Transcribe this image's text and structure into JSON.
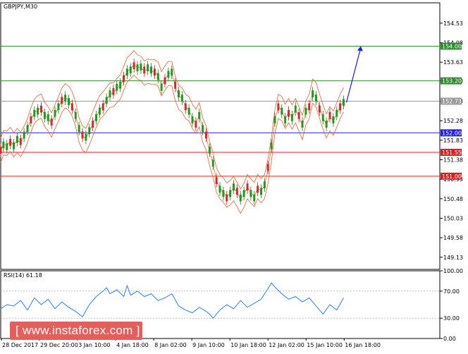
{
  "chart_data": [
    {
      "type": "line",
      "subtype": "candlestick",
      "title": "GBPJPY,M30",
      "xlabel": "",
      "ylabel": "",
      "ylim": [
        148.85,
        155.0
      ],
      "y_tick_labels": [
        "154.53",
        "154.08",
        "153.63",
        "153.20",
        "152.73",
        "152.28",
        "151.83",
        "151.38",
        "150.93",
        "150.48",
        "150.03",
        "149.58",
        "149.13"
      ],
      "x_tick_labels": [
        "28 Dec 2017",
        "29 Dec 20:00",
        "3 Jan 10:00",
        "4 Jan 18:00",
        "8 Jan 02:00",
        "9 Jan 10:00",
        "10 Jan 18:00",
        "12 Jan 02:00",
        "15 Jan 10:00",
        "16 Jan 18:00"
      ],
      "price_labels": [
        {
          "label": "154.00",
          "value": 154.0,
          "color": "#2e8b2e"
        },
        {
          "label": "153.20",
          "value": 153.2,
          "color": "#2e8b2e"
        },
        {
          "label": "152.73",
          "value": 152.73,
          "color": "#9a9a9a"
        },
        {
          "label": "152.00",
          "value": 152.0,
          "color": "#2222dd"
        },
        {
          "label": "151.55",
          "value": 151.55,
          "color": "#d32020"
        },
        {
          "label": "151.00",
          "value": 151.0,
          "color": "#d32020"
        }
      ],
      "series": [
        {
          "values": [
            [
              1,
              151.6
            ],
            [
              5,
              151.72
            ],
            [
              10,
              151.68
            ],
            [
              15,
              151.78
            ],
            [
              20,
              151.7
            ],
            [
              25,
              151.85
            ],
            [
              30,
              151.8
            ],
            [
              35,
              151.95
            ],
            [
              40,
              152.1
            ],
            [
              45,
              152.3
            ],
            [
              50,
              152.45
            ],
            [
              55,
              152.5
            ],
            [
              60,
              152.55
            ],
            [
              65,
              152.4
            ],
            [
              70,
              152.35
            ],
            [
              75,
              152.25
            ],
            [
              80,
              152.45
            ],
            [
              85,
              152.6
            ],
            [
              90,
              152.75
            ],
            [
              95,
              152.8
            ],
            [
              100,
              152.72
            ],
            [
              105,
              152.6
            ],
            [
              110,
              152.4
            ],
            [
              115,
              152.1
            ],
            [
              120,
              151.95
            ],
            [
              125,
              151.9
            ],
            [
              130,
              152.05
            ],
            [
              135,
              152.2
            ],
            [
              140,
              152.35
            ],
            [
              145,
              152.5
            ],
            [
              150,
              152.6
            ],
            [
              155,
              152.75
            ],
            [
              160,
              152.9
            ],
            [
              165,
              152.95
            ],
            [
              170,
              153.05
            ],
            [
              175,
              153.1
            ],
            [
              180,
              153.25
            ],
            [
              185,
              153.4
            ],
            [
              190,
              153.45
            ],
            [
              195,
              153.55
            ],
            [
              200,
              153.5
            ],
            [
              205,
              153.52
            ],
            [
              210,
              153.45
            ],
            [
              215,
              153.5
            ],
            [
              220,
              153.45
            ],
            [
              225,
              153.4
            ],
            [
              230,
              153.3
            ],
            [
              235,
              153.05
            ],
            [
              240,
              153.2
            ],
            [
              245,
              153.35
            ],
            [
              250,
              153.4
            ],
            [
              255,
              153.1
            ],
            [
              260,
              152.9
            ],
            [
              265,
              152.8
            ],
            [
              270,
              152.6
            ],
            [
              275,
              152.5
            ],
            [
              280,
              152.3
            ],
            [
              285,
              152.2
            ],
            [
              290,
              152.4
            ],
            [
              295,
              152.1
            ],
            [
              300,
              151.95
            ],
            [
              305,
              151.6
            ],
            [
              310,
              151.3
            ],
            [
              315,
              150.9
            ],
            [
              320,
              150.7
            ],
            [
              325,
              150.6
            ],
            [
              330,
              150.5
            ],
            [
              335,
              150.6
            ],
            [
              340,
              150.75
            ],
            [
              345,
              150.65
            ],
            [
              350,
              150.5
            ],
            [
              355,
              150.6
            ],
            [
              360,
              150.75
            ],
            [
              365,
              150.6
            ],
            [
              370,
              150.5
            ],
            [
              375,
              150.7
            ],
            [
              380,
              150.65
            ],
            [
              385,
              150.8
            ],
            [
              390,
              151.2
            ],
            [
              395,
              151.7
            ],
            [
              400,
              152.3
            ],
            [
              405,
              152.6
            ],
            [
              410,
              152.5
            ],
            [
              415,
              152.3
            ],
            [
              420,
              152.45
            ],
            [
              425,
              152.35
            ],
            [
              430,
              152.55
            ],
            [
              435,
              152.4
            ],
            [
              440,
              152.2
            ],
            [
              445,
              152.5
            ],
            [
              450,
              152.6
            ],
            [
              455,
              152.9
            ],
            [
              460,
              152.8
            ],
            [
              465,
              152.55
            ],
            [
              470,
              152.35
            ],
            [
              475,
              152.2
            ],
            [
              480,
              152.4
            ],
            [
              485,
              152.3
            ],
            [
              490,
              152.45
            ],
            [
              495,
              152.6
            ],
            [
              500,
              152.7
            ]
          ]
        }
      ]
    },
    {
      "type": "line",
      "title": "RSI(14) 61.18",
      "ylim": [
        0,
        100
      ],
      "y_tick_labels": [
        "100.00",
        "70.00",
        "30.00",
        "0.00"
      ],
      "levels": [
        70,
        30
      ],
      "series": [
        {
          "color": "#2f7fe0",
          "values": [
            [
              1,
              44
            ],
            [
              10,
              50
            ],
            [
              20,
              48
            ],
            [
              30,
              56
            ],
            [
              40,
              42
            ],
            [
              50,
              60
            ],
            [
              60,
              50
            ],
            [
              70,
              58
            ],
            [
              80,
              44
            ],
            [
              90,
              54
            ],
            [
              100,
              46
            ],
            [
              110,
              40
            ],
            [
              120,
              32
            ],
            [
              130,
              50
            ],
            [
              140,
              62
            ],
            [
              150,
              70
            ],
            [
              155,
              75
            ],
            [
              160,
              66
            ],
            [
              170,
              72
            ],
            [
              180,
              62
            ],
            [
              185,
              78
            ],
            [
              190,
              64
            ],
            [
              200,
              70
            ],
            [
              210,
              62
            ],
            [
              220,
              66
            ],
            [
              230,
              56
            ],
            [
              240,
              60
            ],
            [
              250,
              66
            ],
            [
              260,
              48
            ],
            [
              270,
              42
            ],
            [
              280,
              38
            ],
            [
              290,
              46
            ],
            [
              300,
              40
            ],
            [
              305,
              36
            ],
            [
              310,
              30
            ],
            [
              320,
              42
            ],
            [
              330,
              50
            ],
            [
              340,
              44
            ],
            [
              350,
              56
            ],
            [
              360,
              46
            ],
            [
              370,
              52
            ],
            [
              380,
              58
            ],
            [
              390,
              74
            ],
            [
              395,
              82
            ],
            [
              400,
              76
            ],
            [
              410,
              66
            ],
            [
              420,
              58
            ],
            [
              430,
              62
            ],
            [
              440,
              54
            ],
            [
              450,
              60
            ],
            [
              460,
              48
            ],
            [
              470,
              36
            ],
            [
              480,
              50
            ],
            [
              490,
              42
            ],
            [
              500,
              60
            ]
          ]
        }
      ]
    }
  ],
  "watermark": "[ www.instaforex.com ]"
}
